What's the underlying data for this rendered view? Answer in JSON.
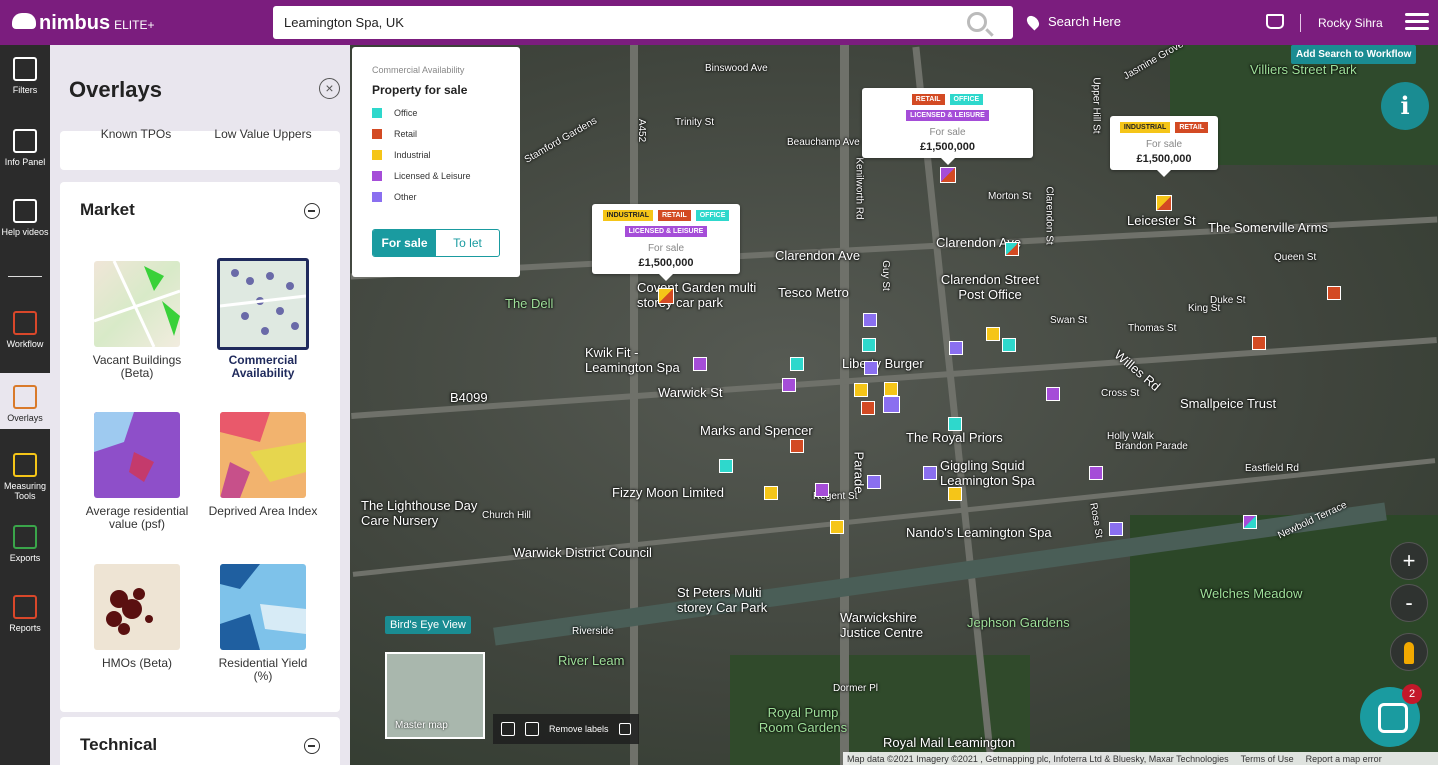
{
  "header": {
    "logo_text": "nimbus",
    "logo_tier": "ELITE+",
    "search_value": "Leamington Spa, UK",
    "search_here_label": "Search Here",
    "user_name": "Rocky Sihra"
  },
  "nav": [
    {
      "label": "Filters"
    },
    {
      "label": "Info Panel"
    },
    {
      "label": "Help videos"
    },
    {
      "label": "Workflow"
    },
    {
      "label": "Overlays"
    },
    {
      "label": "Measuring Tools"
    },
    {
      "label": "Exports"
    },
    {
      "label": "Reports"
    }
  ],
  "overlays": {
    "title": "Overlays",
    "prev_tiles": [
      {
        "label": "Known TPOs"
      },
      {
        "label": "Low Value Uppers"
      }
    ],
    "market": {
      "title": "Market",
      "tiles": [
        {
          "label": "Vacant Buildings (Beta)"
        },
        {
          "label": "Commercial Availability"
        },
        {
          "label": "Average residential value (psf)"
        },
        {
          "label": "Deprived Area Index"
        },
        {
          "label": "HMOs (Beta)"
        },
        {
          "label": "Residential Yield (%)"
        }
      ]
    },
    "technical_title": "Technical"
  },
  "legend": {
    "subtitle": "Commercial Availability",
    "title": "Property for sale",
    "items": [
      {
        "label": "Office",
        "color": "#2ed8cc"
      },
      {
        "label": "Retail",
        "color": "#d34a23"
      },
      {
        "label": "Industrial",
        "color": "#f5c518"
      },
      {
        "label": "Licensed & Leisure",
        "color": "#a54dd8"
      },
      {
        "label": "Other",
        "color": "#8a6ff0"
      }
    ],
    "toggle_sale": "For sale",
    "toggle_let": "To let"
  },
  "popups": [
    {
      "badges": [
        "INDUSTRIAL",
        "RETAIL",
        "OFFICE",
        "LICENSED & LEISURE"
      ],
      "status": "For sale",
      "price": "£1,500,000"
    },
    {
      "badges": [
        "RETAIL",
        "OFFICE",
        "LICENSED & LEISURE"
      ],
      "status": "For sale",
      "price": "£1,500,000"
    },
    {
      "badges": [
        "INDUSTRIAL",
        "RETAIL"
      ],
      "status": "For sale",
      "price": "£1,500,000"
    }
  ],
  "map": {
    "add_to_workflow": "Add Search to Workflow",
    "birds_eye": "Bird's Eye View",
    "master_map": "Master map",
    "remove_labels": "Remove labels",
    "attribution": "Map data ©2021 Imagery ©2021 , Getmapping plc, Infoterra Ltd & Bluesky, Maxar Technologies",
    "terms": "Terms of Use",
    "report": "Report a map error",
    "chat_count": "2",
    "labels": [
      "Binswood Ave",
      "Trinity St",
      "Beauchamp Ave",
      "Clarendon Ave",
      "Clarendon Ave",
      "Clarendon Street Post Office",
      "Tesco Metro",
      "Kwik Fit - Leamington Spa",
      "Warwick St",
      "B4099",
      "Marks and Spencer",
      "The Royal Priors",
      "Fizzy Moon Limited",
      "Giggling Squid Leamington Spa",
      "Nando's Leamington Spa",
      "Warwick District Council",
      "St Peters Multi storey Car Park",
      "Warwickshire Justice Centre",
      "Jephson Gardens",
      "River Leam",
      "Royal Pump Room Gardens",
      "Royal Mail Leamington",
      "The Somerville Arms",
      "Smallpeice Trust",
      "Welches Meadow",
      "Villiers Street Park",
      "The Dell",
      "The Lighthouse Day Care Nursery",
      "Leicester St",
      "Queen St",
      "Duke St",
      "Willes Rd",
      "Brandon Parade",
      "Newbold Terrace",
      "Regent St",
      "Parade",
      "Liberty Burger",
      "A452",
      "Kenilworth Rd",
      "Clarendon St",
      "Church Hill",
      "Dormer Pl",
      "Riverside",
      "Rose St",
      "Holly Walk",
      "Eastfield Rd",
      "Cross St",
      "Thomas St",
      "Swan St",
      "King St",
      "Morton St",
      "Covent Garden multi storey car park",
      "Guy St",
      "Parade",
      "Stamford Gardens",
      "Jasmine Grove",
      "Upper Hill St"
    ]
  }
}
